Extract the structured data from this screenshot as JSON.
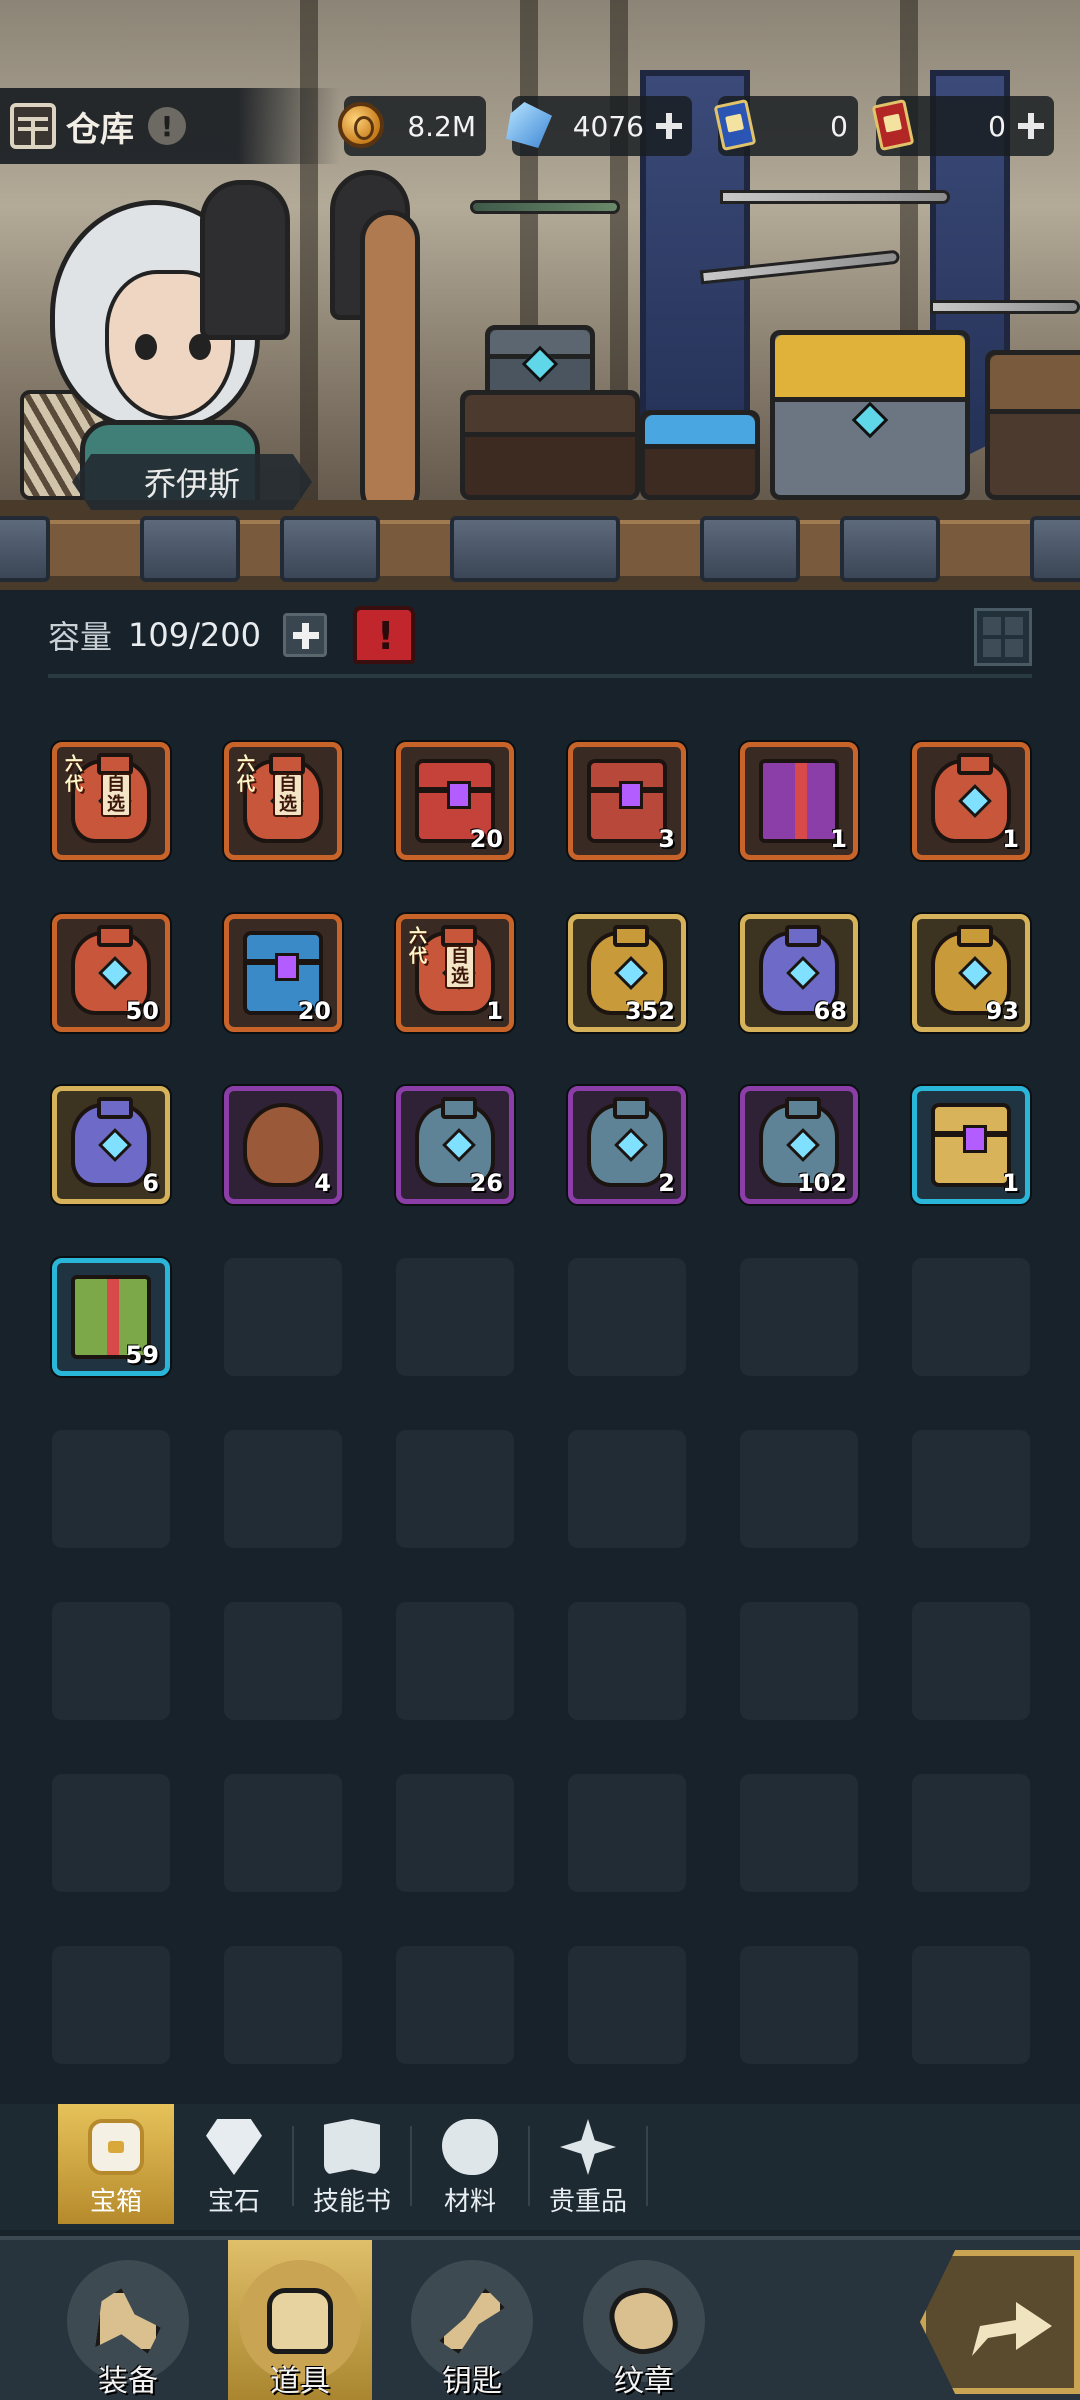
{
  "header": {
    "title": "仓库",
    "info_icon": "!",
    "resources": [
      {
        "icon": "gold-coin-icon",
        "value": "8.2M",
        "has_plus": false
      },
      {
        "icon": "crystal-icon",
        "value": "4076",
        "has_plus": true
      },
      {
        "icon": "blue-ticket-icon",
        "value": "0",
        "has_plus": false
      },
      {
        "icon": "gold-ticket-icon",
        "value": "0",
        "has_plus": true
      }
    ]
  },
  "scene": {
    "character_name": "乔伊斯"
  },
  "capacity": {
    "label": "容量",
    "value": "109/200"
  },
  "inventory": {
    "items": [
      {
        "art": "six-gen-select-vase",
        "rarity": "orange",
        "six_label": "六代",
        "select_label": "自选",
        "count": ""
      },
      {
        "art": "six-gen-select-vase",
        "rarity": "orange",
        "six_label": "六代",
        "select_label": "自选",
        "count": ""
      },
      {
        "art": "red-chest",
        "rarity": "orange",
        "count": "20"
      },
      {
        "art": "red-box",
        "rarity": "orange",
        "count": "3"
      },
      {
        "art": "purple-gift-box",
        "rarity": "orange",
        "count": "1"
      },
      {
        "art": "red-vase",
        "rarity": "orange",
        "count": "1"
      },
      {
        "art": "red-vase",
        "rarity": "orange",
        "count": "50"
      },
      {
        "art": "blue-gold-chest",
        "rarity": "orange",
        "count": "20"
      },
      {
        "art": "six-gen-select-vase",
        "rarity": "orange",
        "six_label": "六代",
        "select_label": "自选",
        "count": "1"
      },
      {
        "art": "gold-vase",
        "rarity": "gold",
        "count": "352"
      },
      {
        "art": "purple-vase",
        "rarity": "gold",
        "count": "68"
      },
      {
        "art": "gold-vase",
        "rarity": "gold",
        "count": "93"
      },
      {
        "art": "purple-vase",
        "rarity": "gold",
        "count": "6"
      },
      {
        "art": "loot-bag",
        "rarity": "purple",
        "count": "4"
      },
      {
        "art": "steel-vase",
        "rarity": "purple",
        "count": "26"
      },
      {
        "art": "steel-vase",
        "rarity": "purple",
        "count": "2"
      },
      {
        "art": "steel-vase",
        "rarity": "purple",
        "count": "102"
      },
      {
        "art": "paw-chest",
        "rarity": "cyan",
        "count": "1"
      },
      {
        "art": "green-gift-box",
        "rarity": "cyan",
        "count": "59"
      }
    ],
    "empty_slots": 29
  },
  "categories": [
    {
      "icon": "chest-icon",
      "label": "宝箱",
      "active": true
    },
    {
      "icon": "gem-icon",
      "label": "宝石",
      "active": false
    },
    {
      "icon": "book-icon",
      "label": "技能书",
      "active": false
    },
    {
      "icon": "material-icon",
      "label": "材料",
      "active": false
    },
    {
      "icon": "valuable-icon",
      "label": "贵重品",
      "active": false
    }
  ],
  "bottom_nav": [
    {
      "icon": "equipment-icon",
      "label": "装备",
      "active": false
    },
    {
      "icon": "items-icon",
      "label": "道具",
      "active": true
    },
    {
      "icon": "key-icon",
      "label": "钥匙",
      "active": false
    },
    {
      "icon": "badge-icon",
      "label": "纹章",
      "active": false
    }
  ],
  "colors": {
    "background": "#18222a",
    "rarity_orange": "#c8632a",
    "rarity_gold": "#d6b25a",
    "rarity_purple": "#8c3ea8",
    "rarity_cyan": "#2ab6d8",
    "active_tab": "#e6c25a"
  }
}
